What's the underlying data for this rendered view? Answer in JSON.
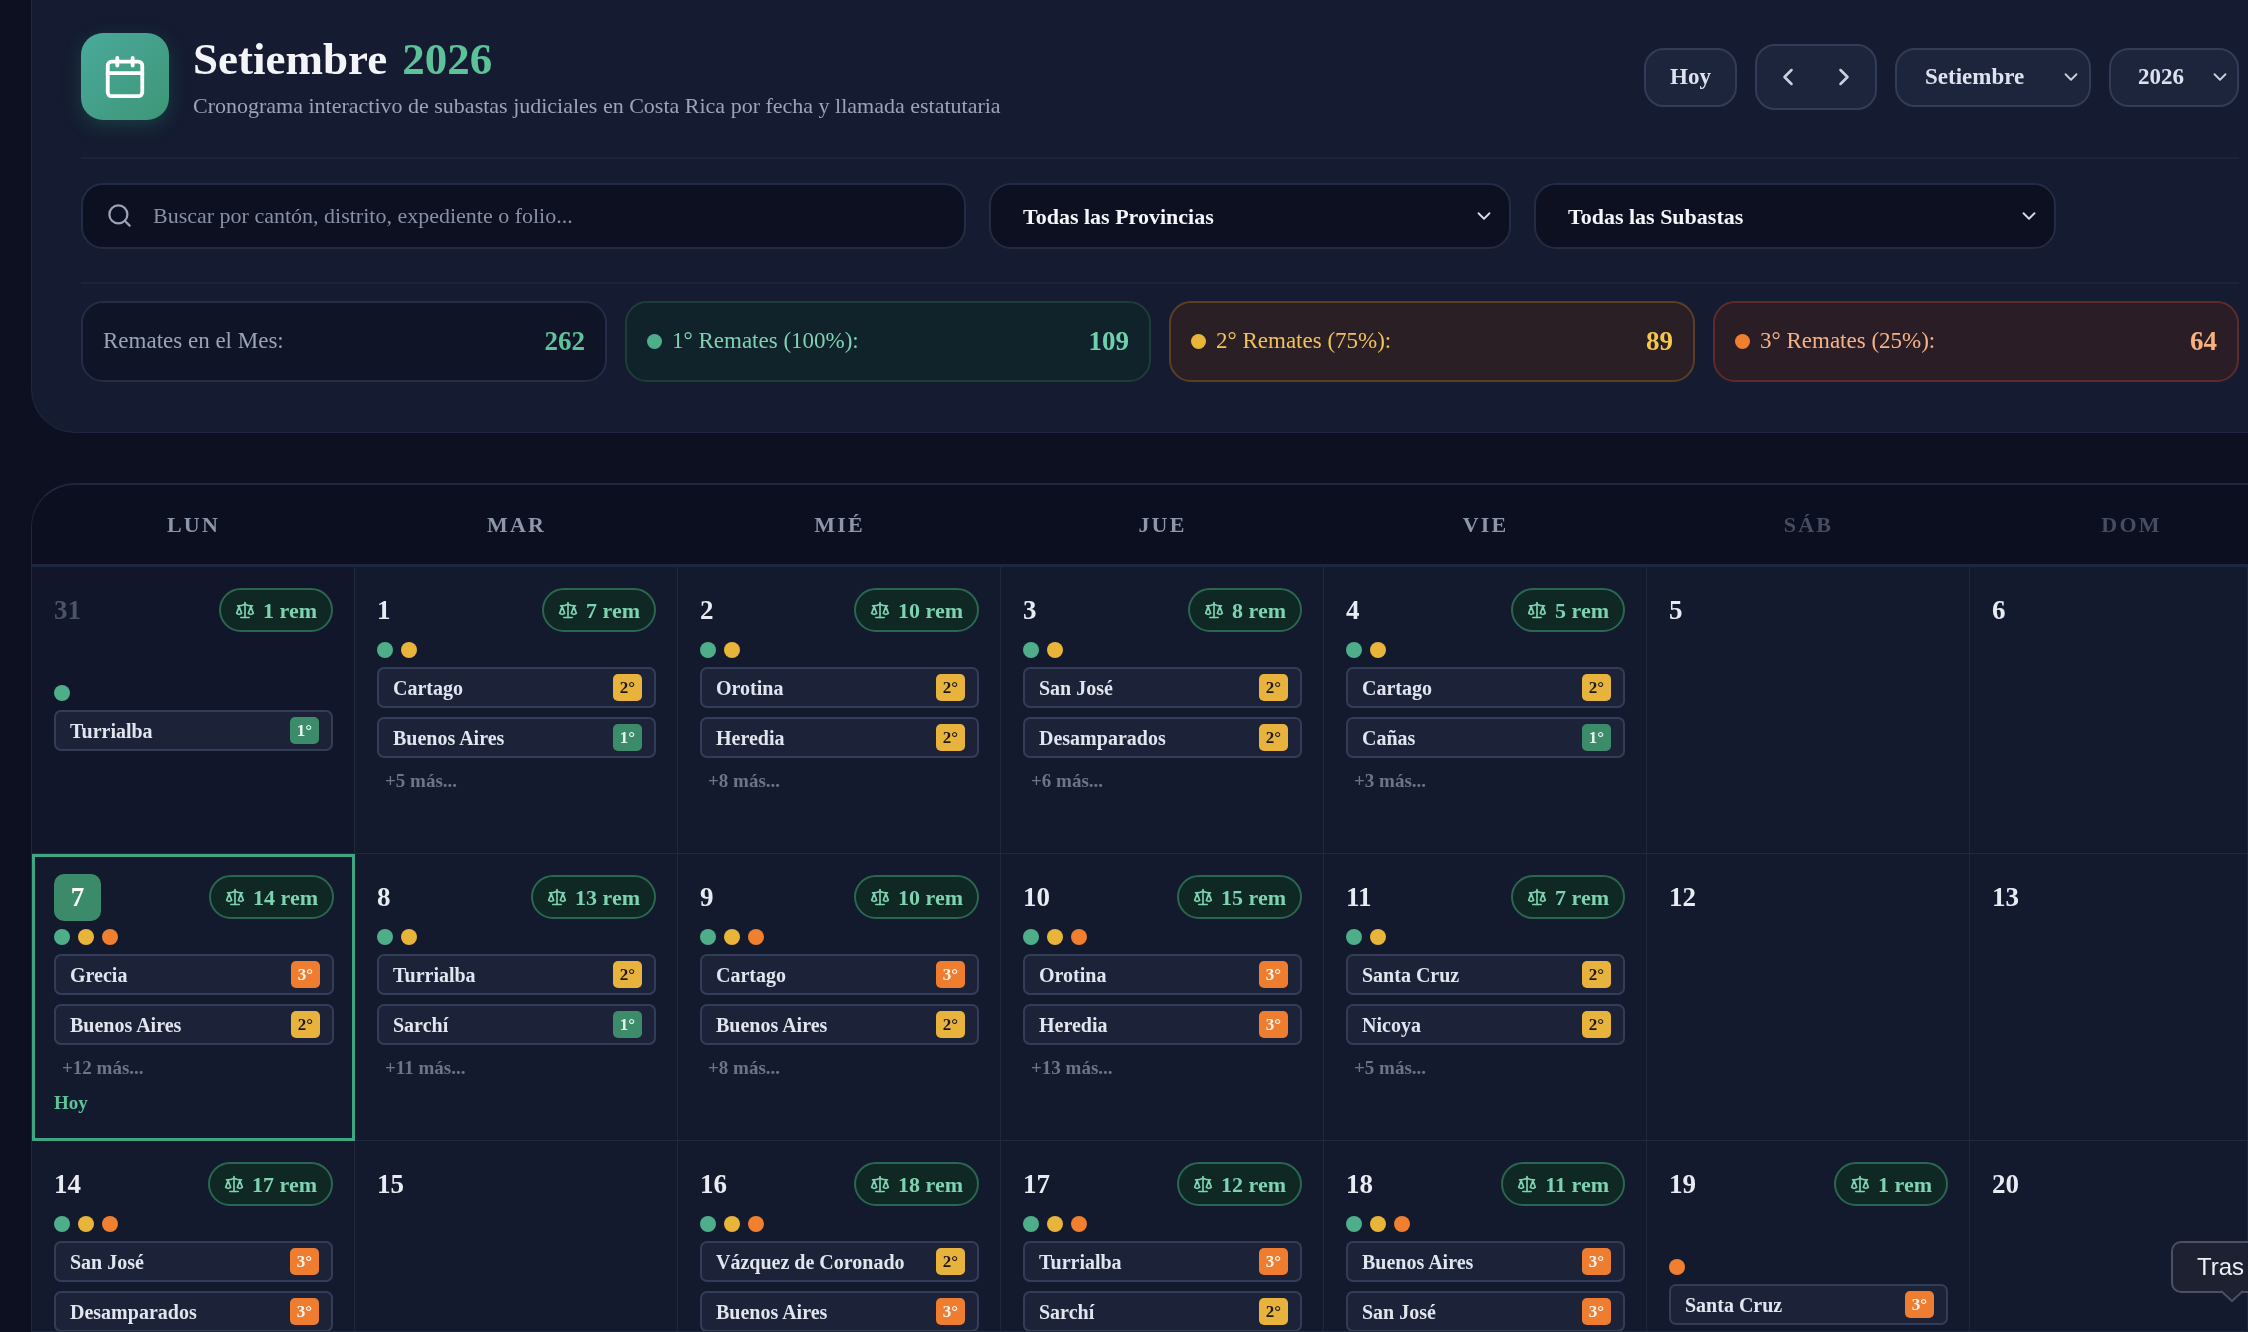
{
  "header": {
    "title": "Setiembre",
    "year": "2026",
    "subtitle": "Cronograma interactivo de subastas judiciales en Costa Rica por fecha y llamada estatutaria",
    "today_button": "Hoy",
    "month_select": "Setiembre",
    "year_select": "2026"
  },
  "filters": {
    "search": {
      "placeholder": "Buscar por cantón, distrito, expediente o folio..."
    },
    "province_select": "Todas las Provincias",
    "auction_select": "Todas las Subastas"
  },
  "stats": [
    {
      "kind": "total",
      "label": "Remates en el Mes:",
      "value": "262"
    },
    {
      "kind": "first",
      "label": "1° Remates (100%):",
      "value": "109",
      "color": "#4fae8a"
    },
    {
      "kind": "second",
      "label": "2° Remates (75%):",
      "value": "89",
      "color": "#e9b43a"
    },
    {
      "kind": "third",
      "label": "3° Remates (25%):",
      "value": "64",
      "color": "#f07f2f"
    }
  ],
  "calendar": {
    "weekdays": [
      {
        "label": "LUN",
        "weekend": false
      },
      {
        "label": "MAR",
        "weekend": false
      },
      {
        "label": "MIÉ",
        "weekend": false
      },
      {
        "label": "JUE",
        "weekend": false
      },
      {
        "label": "VIE",
        "weekend": false
      },
      {
        "label": "SÁB",
        "weekend": true
      },
      {
        "label": "DOM",
        "weekend": true
      }
    ],
    "weeks": [
      [
        {
          "day": "31",
          "outside": true,
          "today": false,
          "count": "1 rem",
          "dots": [
            {
              "color": "#4fae8a"
            }
          ],
          "events": [
            {
              "place": "Turrialba",
              "call": "1°",
              "kind": "first"
            }
          ]
        },
        {
          "day": "1",
          "outside": false,
          "today": false,
          "count": "7 rem",
          "dots": [
            {
              "color": "#4fae8a"
            },
            {
              "color": "#e9b43a"
            }
          ],
          "events": [
            {
              "place": "Cartago",
              "call": "2°",
              "kind": "second"
            },
            {
              "place": "Buenos Aires",
              "call": "1°",
              "kind": "first"
            }
          ],
          "more": "+5 más..."
        },
        {
          "day": "2",
          "outside": false,
          "today": false,
          "count": "10 rem",
          "dots": [
            {
              "color": "#4fae8a"
            },
            {
              "color": "#e9b43a"
            }
          ],
          "events": [
            {
              "place": "Orotina",
              "call": "2°",
              "kind": "second"
            },
            {
              "place": "Heredia",
              "call": "2°",
              "kind": "second"
            }
          ],
          "more": "+8 más..."
        },
        {
          "day": "3",
          "outside": false,
          "today": false,
          "count": "8 rem",
          "dots": [
            {
              "color": "#4fae8a"
            },
            {
              "color": "#e9b43a"
            }
          ],
          "events": [
            {
              "place": "San José",
              "call": "2°",
              "kind": "second"
            },
            {
              "place": "Desamparados",
              "call": "2°",
              "kind": "second"
            }
          ],
          "more": "+6 más..."
        },
        {
          "day": "4",
          "outside": false,
          "today": false,
          "count": "5 rem",
          "dots": [
            {
              "color": "#4fae8a"
            },
            {
              "color": "#e9b43a"
            }
          ],
          "events": [
            {
              "place": "Cartago",
              "call": "2°",
              "kind": "second"
            },
            {
              "place": "Cañas",
              "call": "1°",
              "kind": "first"
            }
          ],
          "more": "+3 más..."
        },
        {
          "day": "5",
          "outside": false,
          "today": false
        },
        {
          "day": "6",
          "outside": false,
          "today": false
        }
      ],
      [
        {
          "day": "7",
          "outside": false,
          "today": true,
          "count": "14 rem",
          "dots": [
            {
              "color": "#4fae8a"
            },
            {
              "color": "#e9b43a"
            },
            {
              "color": "#f07f2f"
            }
          ],
          "events": [
            {
              "place": "Grecia",
              "call": "3°",
              "kind": "third"
            },
            {
              "place": "Buenos Aires",
              "call": "2°",
              "kind": "second"
            }
          ],
          "more": "+12 más...",
          "today_label": "Hoy"
        },
        {
          "day": "8",
          "outside": false,
          "today": false,
          "count": "13 rem",
          "dots": [
            {
              "color": "#4fae8a"
            },
            {
              "color": "#e9b43a"
            }
          ],
          "events": [
            {
              "place": "Turrialba",
              "call": "2°",
              "kind": "second"
            },
            {
              "place": "Sarchí",
              "call": "1°",
              "kind": "first"
            }
          ],
          "more": "+11 más..."
        },
        {
          "day": "9",
          "outside": false,
          "today": false,
          "count": "10 rem",
          "dots": [
            {
              "color": "#4fae8a"
            },
            {
              "color": "#e9b43a"
            },
            {
              "color": "#f07f2f"
            }
          ],
          "events": [
            {
              "place": "Cartago",
              "call": "3°",
              "kind": "third"
            },
            {
              "place": "Buenos Aires",
              "call": "2°",
              "kind": "second"
            }
          ],
          "more": "+8 más..."
        },
        {
          "day": "10",
          "outside": false,
          "today": false,
          "count": "15 rem",
          "dots": [
            {
              "color": "#4fae8a"
            },
            {
              "color": "#e9b43a"
            },
            {
              "color": "#f07f2f"
            }
          ],
          "events": [
            {
              "place": "Orotina",
              "call": "3°",
              "kind": "third"
            },
            {
              "place": "Heredia",
              "call": "3°",
              "kind": "third"
            }
          ],
          "more": "+13 más..."
        },
        {
          "day": "11",
          "outside": false,
          "today": false,
          "count": "7 rem",
          "dots": [
            {
              "color": "#4fae8a"
            },
            {
              "color": "#e9b43a"
            }
          ],
          "events": [
            {
              "place": "Santa Cruz",
              "call": "2°",
              "kind": "second"
            },
            {
              "place": "Nicoya",
              "call": "2°",
              "kind": "second"
            }
          ],
          "more": "+5 más..."
        },
        {
          "day": "12",
          "outside": false,
          "today": false
        },
        {
          "day": "13",
          "outside": false,
          "today": false
        }
      ],
      [
        {
          "day": "14",
          "outside": false,
          "today": false,
          "count": "17 rem",
          "dots": [
            {
              "color": "#4fae8a"
            },
            {
              "color": "#e9b43a"
            },
            {
              "color": "#f07f2f"
            }
          ],
          "events": [
            {
              "place": "San José",
              "call": "3°",
              "kind": "third"
            },
            {
              "place": "Desamparados",
              "call": "3°",
              "kind": "third"
            }
          ]
        },
        {
          "day": "15",
          "outside": false,
          "today": false
        },
        {
          "day": "16",
          "outside": false,
          "today": false,
          "count": "18 rem",
          "dots": [
            {
              "color": "#4fae8a"
            },
            {
              "color": "#e9b43a"
            },
            {
              "color": "#f07f2f"
            }
          ],
          "events": [
            {
              "place": "Vázquez de Coronado",
              "call": "2°",
              "kind": "second"
            },
            {
              "place": "Buenos Aires",
              "call": "3°",
              "kind": "third"
            }
          ]
        },
        {
          "day": "17",
          "outside": false,
          "today": false,
          "count": "12 rem",
          "dots": [
            {
              "color": "#4fae8a"
            },
            {
              "color": "#e9b43a"
            },
            {
              "color": "#f07f2f"
            }
          ],
          "events": [
            {
              "place": "Turrialba",
              "call": "3°",
              "kind": "third"
            },
            {
              "place": "Sarchí",
              "call": "2°",
              "kind": "second"
            }
          ]
        },
        {
          "day": "18",
          "outside": false,
          "today": false,
          "count": "11 rem",
          "dots": [
            {
              "color": "#4fae8a"
            },
            {
              "color": "#e9b43a"
            },
            {
              "color": "#f07f2f"
            }
          ],
          "events": [
            {
              "place": "Buenos Aires",
              "call": "3°",
              "kind": "third"
            },
            {
              "place": "San José",
              "call": "3°",
              "kind": "third"
            }
          ]
        },
        {
          "day": "19",
          "outside": false,
          "today": false,
          "count": "1 rem",
          "dots": [
            {
              "color": "#f07f2f"
            }
          ],
          "events": [
            {
              "place": "Santa Cruz",
              "call": "3°",
              "kind": "third"
            }
          ]
        },
        {
          "day": "20",
          "outside": false,
          "today": false
        }
      ]
    ]
  },
  "tooltip": {
    "text": "Tras"
  }
}
